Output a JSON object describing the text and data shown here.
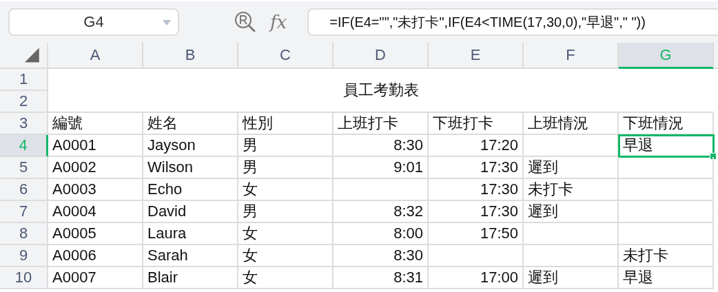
{
  "formula_bar": {
    "name_box": "G4",
    "function_label": "fx",
    "formula": "=IF(E4=\"\",\"未打卡\",IF(E4<TIME(17,30,0),\"早退\",\" \"))"
  },
  "columns": [
    {
      "label": "A",
      "kind": "text",
      "selected": false
    },
    {
      "label": "B",
      "kind": "text",
      "selected": false
    },
    {
      "label": "C",
      "kind": "text",
      "selected": false
    },
    {
      "label": "D",
      "kind": "time",
      "selected": false
    },
    {
      "label": "E",
      "kind": "time",
      "selected": false
    },
    {
      "label": "F",
      "kind": "text",
      "selected": false
    },
    {
      "label": "G",
      "kind": "text",
      "selected": true
    }
  ],
  "title": {
    "rows": [
      "1",
      "2"
    ],
    "text": "員工考勤表"
  },
  "rows": [
    {
      "number": "3",
      "selected": false,
      "kind": "header",
      "cells": [
        "編號",
        "姓名",
        "性別",
        "上班打卡",
        "下班打卡",
        "上班情況",
        "下班情況"
      ]
    },
    {
      "number": "4",
      "selected": true,
      "cells": [
        "A0001",
        "Jayson",
        "男",
        "8:30",
        "17:20",
        null,
        "早退"
      ]
    },
    {
      "number": "5",
      "selected": false,
      "cells": [
        "A0002",
        "Wilson",
        "男",
        "9:01",
        "17:30",
        "遲到",
        null
      ]
    },
    {
      "number": "6",
      "selected": false,
      "cells": [
        "A0003",
        "Echo",
        "女",
        null,
        "17:30",
        "未打卡",
        null
      ]
    },
    {
      "number": "7",
      "selected": false,
      "cells": [
        "A0004",
        "David",
        "男",
        "8:32",
        "17:30",
        "遲到",
        null
      ]
    },
    {
      "number": "8",
      "selected": false,
      "cells": [
        "A0005",
        "Laura",
        "女",
        "8:00",
        "17:50",
        null,
        null
      ]
    },
    {
      "number": "9",
      "selected": false,
      "cells": [
        "A0006",
        "Sarah",
        "女",
        "8:30",
        null,
        null,
        "未打卡"
      ]
    },
    {
      "number": "10",
      "selected": false,
      "cells": [
        "A0007",
        "Blair",
        "女",
        "8:31",
        "17:00",
        "遲到",
        "早退"
      ]
    }
  ]
}
